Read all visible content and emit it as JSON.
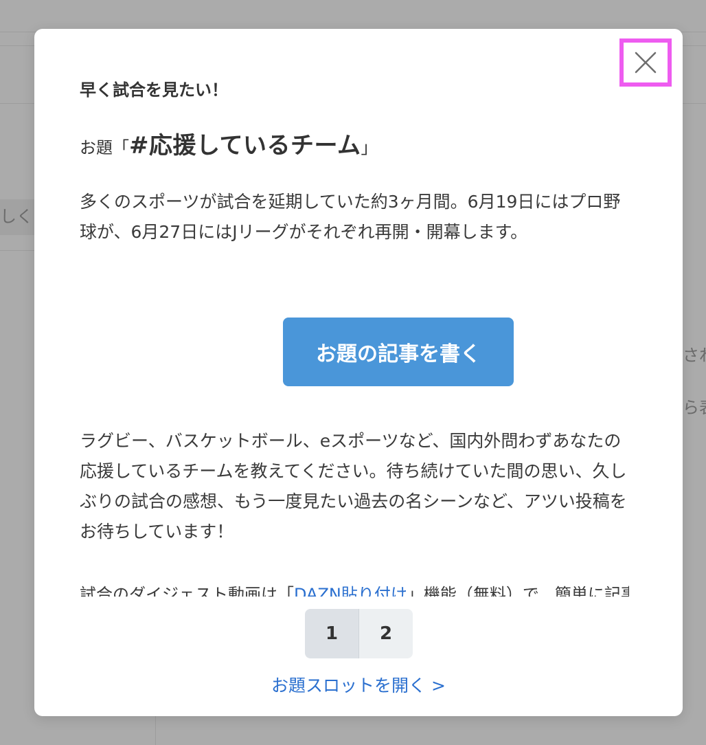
{
  "background": {
    "snippet_left": "しく",
    "snippet_right_1": "され",
    "snippet_right_2": "ら表"
  },
  "modal": {
    "subtitle": "早く試合を見たい！",
    "theme_prefix": "お題「",
    "theme_tag": "#応援しているチーム",
    "theme_suffix": "」",
    "paragraph_1": "多くのスポーツが試合を延期していた約3ヶ月間。6月19日にはプロ野球が、6月27日にはJリーグがそれぞれ再開・開幕します。",
    "write_button_label": "お題の記事を書く",
    "paragraph_2": "ラグビー、バスケットボール、eスポーツなど、国内外問わずあなたの応援しているチームを教えてください。待ち続けていた間の思い、久しぶりの試合の感想、もう一度見たい過去の名シーンなど、アツい投稿をお待ちしています！",
    "clipped_text_before": "試合のダイジェスト動画は「",
    "clipped_link": "DAZN貼り付け",
    "clipped_text_after": "」機能（無料）で、簡単に記事に貼",
    "pagination": [
      "1",
      "2"
    ],
    "active_page": "1",
    "slot_link": "お題スロットを開く >"
  },
  "colors": {
    "overlay": "#ababab",
    "primary_button": "#4a96d9",
    "link": "#2a6fcf",
    "close_highlight": "#ee5cf0"
  },
  "icons": {
    "close": "close-icon"
  }
}
